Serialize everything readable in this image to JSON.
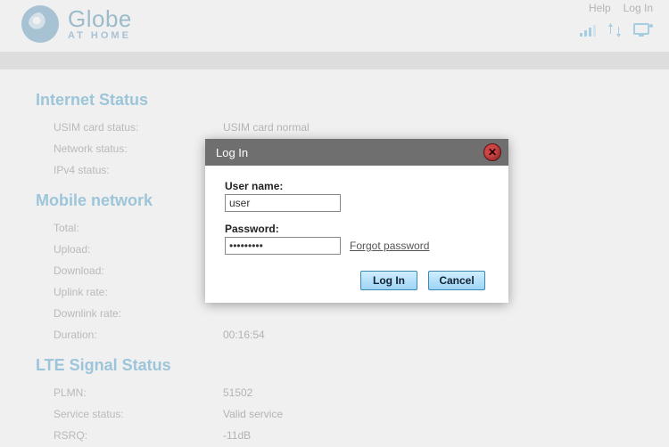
{
  "header": {
    "brand_title": "Globe",
    "brand_sub": "AT HOME",
    "help_label": "Help",
    "login_label": "Log In"
  },
  "sections": {
    "internet": {
      "title": "Internet Status",
      "rows": [
        {
          "label": "USIM card status:",
          "value": "USIM card normal"
        },
        {
          "label": "Network status:",
          "value": ""
        },
        {
          "label": "IPv4 status:",
          "value": ""
        }
      ]
    },
    "mobile": {
      "title": "Mobile network",
      "rows": [
        {
          "label": "Total:",
          "value": ""
        },
        {
          "label": "Upload:",
          "value": ""
        },
        {
          "label": "Download:",
          "value": ""
        },
        {
          "label": "Uplink rate:",
          "value": ""
        },
        {
          "label": "Downlink rate:",
          "value": ""
        },
        {
          "label": "Duration:",
          "value": "00:16:54"
        }
      ]
    },
    "lte": {
      "title": "LTE Signal Status",
      "rows": [
        {
          "label": "PLMN:",
          "value": "51502"
        },
        {
          "label": "Service status:",
          "value": "Valid service"
        },
        {
          "label": "RSRQ:",
          "value": "-11dB"
        }
      ]
    }
  },
  "modal": {
    "title": "Log In",
    "username_label": "User name:",
    "username_value": "user",
    "password_label": "Password:",
    "password_value": "•••••••••",
    "forgot_label": "Forgot password",
    "login_btn": "Log In",
    "cancel_btn": "Cancel"
  }
}
